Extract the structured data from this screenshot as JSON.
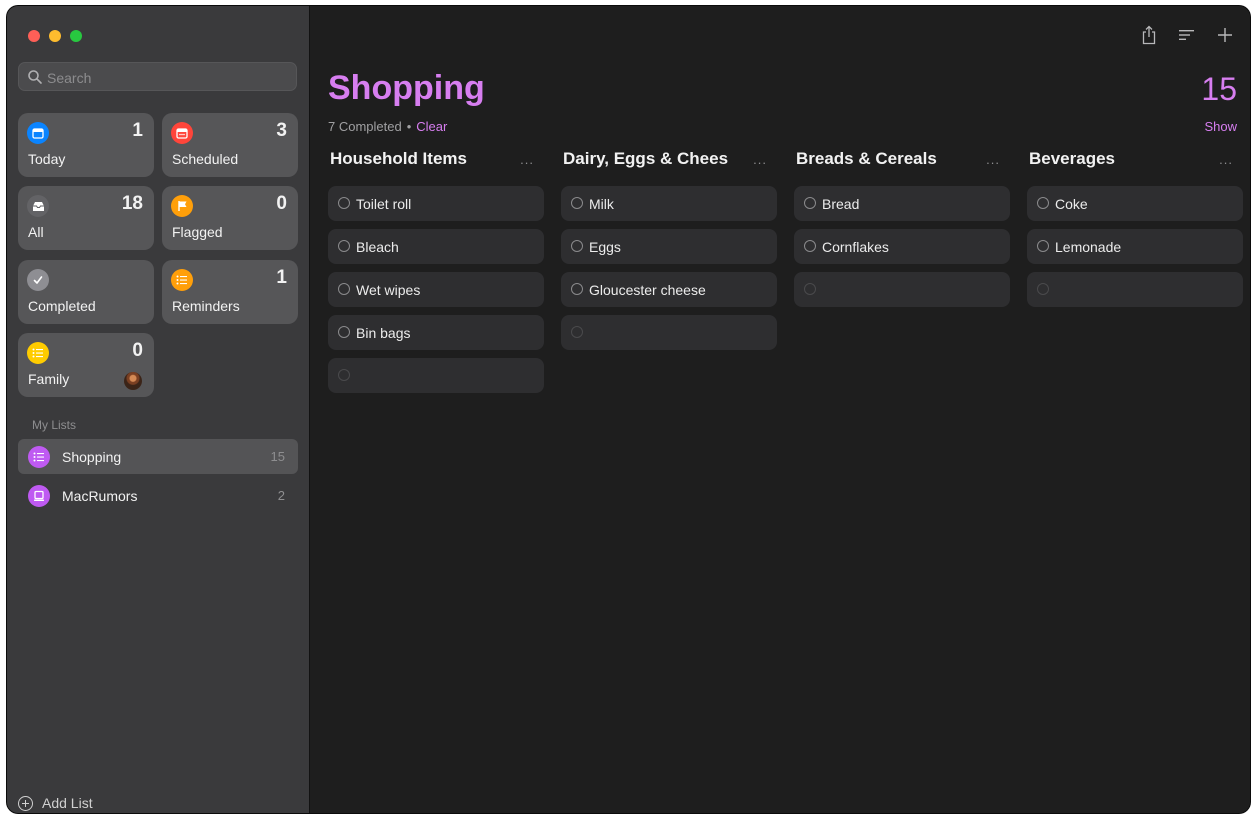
{
  "search": {
    "placeholder": "Search"
  },
  "smart_lists": [
    {
      "label": "Today",
      "count": "1",
      "color": "#0a84ff",
      "icon": "calendar-icon"
    },
    {
      "label": "Scheduled",
      "count": "3",
      "color": "#ff453a",
      "icon": "calendar-grid-icon"
    },
    {
      "label": "All",
      "count": "18",
      "color": "#636366",
      "icon": "tray-icon"
    },
    {
      "label": "Flagged",
      "count": "0",
      "color": "#ff9f0a",
      "icon": "flag-icon"
    },
    {
      "label": "Completed",
      "count": "",
      "color": "#8e8e93",
      "icon": "checkmark-icon"
    },
    {
      "label": "Reminders",
      "count": "1",
      "color": "#ff9f0a",
      "icon": "list-icon"
    },
    {
      "label": "Family",
      "count": "0",
      "color": "#ffcc00",
      "icon": "list-icon"
    }
  ],
  "my_lists": {
    "heading": "My Lists",
    "items": [
      {
        "name": "Shopping",
        "count": "15",
        "color": "#bf5af2",
        "icon": "list-icon",
        "selected": true
      },
      {
        "name": "MacRumors",
        "count": "2",
        "color": "#bf5af2",
        "icon": "laptop-icon",
        "selected": false
      }
    ]
  },
  "add_list_label": "Add List",
  "main": {
    "title": "Shopping",
    "count": "15",
    "completed_text": "7 Completed",
    "separator": "•",
    "clear_label": "Clear",
    "show_label": "Show",
    "more_label": "...",
    "columns": [
      {
        "header": "Household Items",
        "items": [
          "Toilet roll",
          "Bleach",
          "Wet wipes",
          "Bin bags"
        ]
      },
      {
        "header": "Dairy, Eggs & Chees",
        "items": [
          "Milk",
          "Eggs",
          "Gloucester cheese"
        ]
      },
      {
        "header": "Breads & Cereals",
        "items": [
          "Bread",
          "Cornflakes"
        ]
      },
      {
        "header": "Beverages",
        "items": [
          "Coke",
          "Lemonade"
        ]
      }
    ]
  },
  "colors": {
    "accent": "#d77ef0",
    "sidebar": "#3a3a3c",
    "background": "#1e1e1e",
    "card": "#2e2e30"
  }
}
